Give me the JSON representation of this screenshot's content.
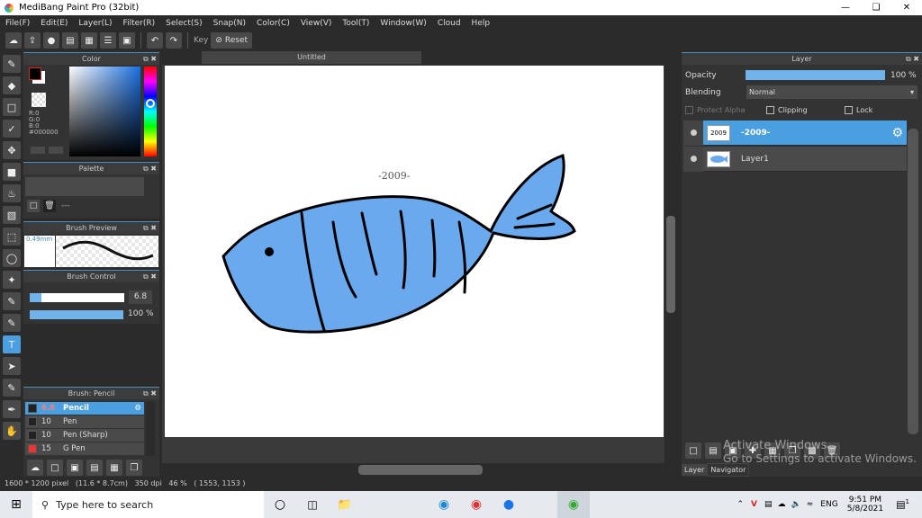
{
  "app": {
    "title": "MediBang Paint Pro (32bit)"
  },
  "menu": [
    "File(F)",
    "Edit(E)",
    "Layer(L)",
    "Filter(R)",
    "Select(S)",
    "Snap(N)",
    "Color(C)",
    "View(V)",
    "Tool(T)",
    "Window(W)",
    "Cloud",
    "Help"
  ],
  "toolbar": {
    "key_label": "Key",
    "reset_label": "Reset"
  },
  "color_panel": {
    "title": "Color",
    "r": "R:0",
    "g": "G:0",
    "b": "B:0",
    "hex": "#000000",
    "fg": "#000000",
    "bg": "#ffffff"
  },
  "palette_panel": {
    "title": "Palette",
    "label": "---"
  },
  "brush_preview": {
    "title": "Brush Preview",
    "size": "0.49mm"
  },
  "brush_control": {
    "title": "Brush Control",
    "size_value": "6.8",
    "opacity_value": "100 %",
    "opacity_percent": 100
  },
  "brush_list": {
    "title": "Brush: Pencil",
    "items": [
      {
        "size": "6.8",
        "name": "Pencil",
        "color": "#222222",
        "selected": true
      },
      {
        "size": "10",
        "name": "Pen",
        "color": "#222222"
      },
      {
        "size": "10",
        "name": "Pen (Sharp)",
        "color": "#222222"
      },
      {
        "size": "15",
        "name": "G Pen",
        "color": "#ee3333"
      }
    ]
  },
  "document": {
    "tab": "Untitled",
    "text": "-2009-",
    "fish_color": "#6aa9ee"
  },
  "layer_panel": {
    "title": "Layer",
    "opacity_label": "Opacity",
    "opacity_value": "100 %",
    "opacity_percent": 100,
    "blending_label": "Blending",
    "blending_value": "Normal",
    "protect_alpha": "Protect Alpha",
    "clipping": "Clipping",
    "lock": "Lock",
    "layers": [
      {
        "name": "-2009-",
        "thumb": "2009",
        "selected": true
      },
      {
        "name": "Layer1"
      }
    ],
    "tabs": [
      "Layer",
      "Navigator"
    ]
  },
  "watermark": {
    "line1": "Activate Windows",
    "line2": "Go to Settings to activate Windows."
  },
  "status": {
    "text": "1600 * 1200 pixel   (11.6 * 8.7cm)   350 dpi   46 %   ( 1553, 1153 )"
  },
  "taskbar": {
    "search_placeholder": "Type here to search",
    "time": "9:51 PM",
    "date": "5/8/2021",
    "lang": "ENG",
    "notifications": "1"
  }
}
